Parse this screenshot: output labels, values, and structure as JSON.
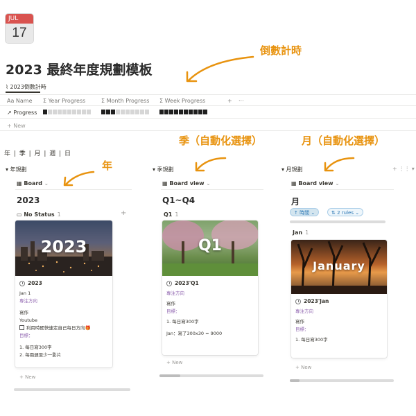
{
  "calendar": {
    "month": "JUL",
    "day": "17"
  },
  "page_title": "2023 最終年度規劃模板",
  "annotations": {
    "countdown": "倒數計時",
    "year": "年",
    "quarter": "季（自動化選擇）",
    "month": "月（自動化選擇）"
  },
  "countdown_tab": {
    "label": "2023倒數計時"
  },
  "table": {
    "headers": [
      "Aa Name",
      "Σ Year Progress",
      "Σ Month Progress",
      "Σ Week Progress"
    ],
    "add_col": "+",
    "more": "···",
    "row_name": "Progress",
    "new_label": "+ New"
  },
  "progress": {
    "year": 0.08,
    "month": 0.33,
    "week": 1.0
  },
  "view_links": "年 | 季 | 月 | 週 | 日",
  "columns": {
    "year": {
      "toggle": "▾ 年規劃",
      "view": "Board",
      "title": "2023",
      "group": "No Status",
      "group_count": "1",
      "card": {
        "cover_text": "2023",
        "name": "2023",
        "lines": [
          "Jan 1"
        ],
        "focus": "專注方向",
        "writing": "寫作",
        "youtube": "Youtube",
        "checkbox": "利用時間快速定自己每日方向🎁",
        "goal": "目標：",
        "items": [
          "1. 每日寫300字",
          "2. 每兩週至少一影片"
        ]
      },
      "new_label": "+ New"
    },
    "quarter": {
      "toggle": "▾ 季規劃",
      "view": "Board view",
      "title": "Q1~Q4",
      "group": "Q1",
      "group_count": "1",
      "card": {
        "cover_text": "Q1",
        "name": "2023'Q1",
        "focus": "專注方向",
        "writing": "寫作",
        "goal": "目標：",
        "items": [
          "1. 每日寫300字"
        ],
        "extra": "Jan：寫了300x30 = 9000"
      },
      "new_label": "+ New"
    },
    "month": {
      "toggle": "▾ 月規劃",
      "view": "Board view",
      "title": "月",
      "filter1": "↑ 時間 ⌄",
      "filter2": "⇅ 2 rules ⌄",
      "group": "Jan",
      "group_count": "1",
      "card": {
        "cover_text": "January",
        "name": "2023'Jan",
        "focus": "專注方向",
        "writing": "寫作",
        "goal": "目標：",
        "items": [
          "1. 每日寫300字"
        ]
      },
      "new_label": "+ New"
    }
  },
  "colors": {
    "accent": "#e8930f",
    "purple": "#9065b0",
    "blue": "#2b77b5"
  },
  "icons": [
    "calendar-icon",
    "chart-icon",
    "clock-icon",
    "board-icon",
    "book-icon",
    "plus-icon",
    "arrow-icon"
  ]
}
